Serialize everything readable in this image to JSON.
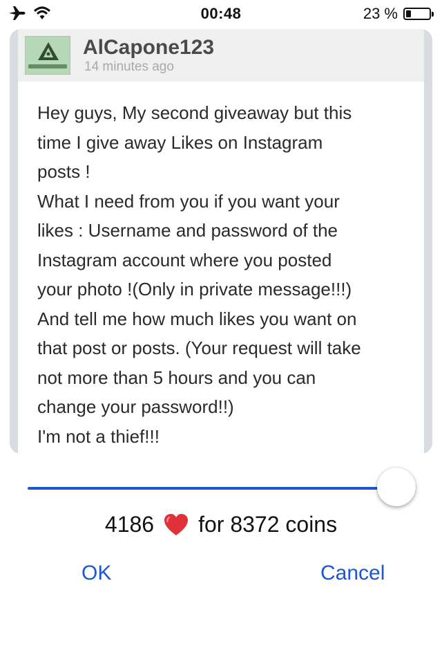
{
  "status_bar": {
    "time": "00:48",
    "battery_text": "23 %",
    "battery_level": 0.23,
    "icons": [
      "airplane-icon",
      "wifi-icon",
      "battery-icon"
    ]
  },
  "post": {
    "username": "AlCapone123",
    "time_ago": "14 minutes ago",
    "avatar_icon": "confirmed-badge-icon",
    "lines": [
      "Hey guys, My second giveaway but this",
      "time I give away Likes on Instagram",
      "posts !",
      "What I need from you if you want your",
      "likes : Username and password of the",
      "Instagram account where you posted",
      "your photo !(Only in private message!!!)",
      "And tell me how much likes you want on",
      "that post or posts. (Your request will take",
      "not more than 5 hours and you can",
      "change your password!!)",
      "I'm not a thief!!!"
    ]
  },
  "slider": {
    "value_fraction": 1.0
  },
  "offer": {
    "likes": "4186",
    "icon": "heart-icon",
    "text": "for 8372 coins"
  },
  "buttons": {
    "ok": "OK",
    "cancel": "Cancel"
  },
  "colors": {
    "accent": "#1a56d6",
    "heart": "#e0303a"
  }
}
